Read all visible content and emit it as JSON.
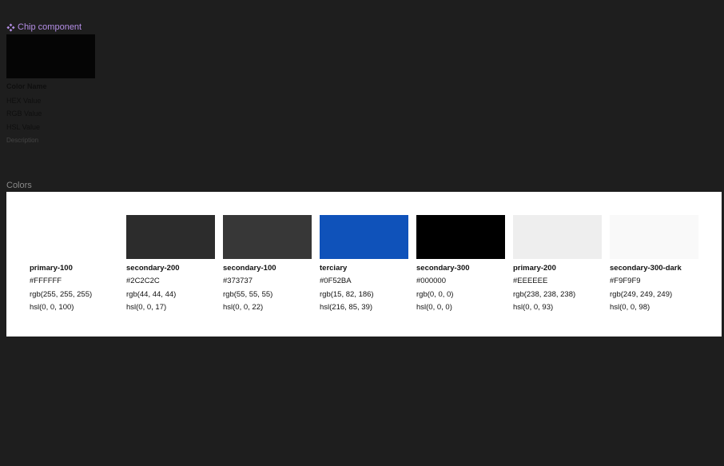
{
  "component": {
    "title": "Chip component",
    "icon": "component-icon",
    "swatch_color": "#050505",
    "color_name": "Color Name",
    "hex": "HEX Value",
    "rgb": "RGB Value",
    "hsl": "HSL Value",
    "description": "Description"
  },
  "section_label": "Colors",
  "colors": [
    {
      "name": "primary-100",
      "hex": "#FFFFFF",
      "rgb": "rgb(255, 255, 255)",
      "hsl": "hsl(0, 0, 100)",
      "swatch": "#FFFFFF"
    },
    {
      "name": "secondary-200",
      "hex": "#2C2C2C",
      "rgb": "rgb(44, 44, 44)",
      "hsl": "hsl(0, 0, 17)",
      "swatch": "#2C2C2C"
    },
    {
      "name": "secondary-100",
      "hex": "#373737",
      "rgb": "rgb(55, 55, 55)",
      "hsl": "hsl(0, 0, 22)",
      "swatch": "#373737"
    },
    {
      "name": "terciary",
      "hex": "#0F52BA",
      "rgb": "rgb(15, 82, 186)",
      "hsl": "hsl(216, 85, 39)",
      "swatch": "#0F52BA"
    },
    {
      "name": "secondary-300",
      "hex": "#000000",
      "rgb": "rgb(0, 0, 0)",
      "hsl": "hsl(0, 0, 0)",
      "swatch": "#000000"
    },
    {
      "name": "primary-200",
      "hex": "#EEEEEE",
      "rgb": "rgb(238, 238, 238)",
      "hsl": "hsl(0, 0, 93)",
      "swatch": "#EEEEEE"
    },
    {
      "name": "secondary-300-dark",
      "hex": "#F9F9F9",
      "rgb": "rgb(249, 249, 249)",
      "hsl": "hsl(0, 0, 98)",
      "swatch": "#F9F9F9"
    }
  ]
}
